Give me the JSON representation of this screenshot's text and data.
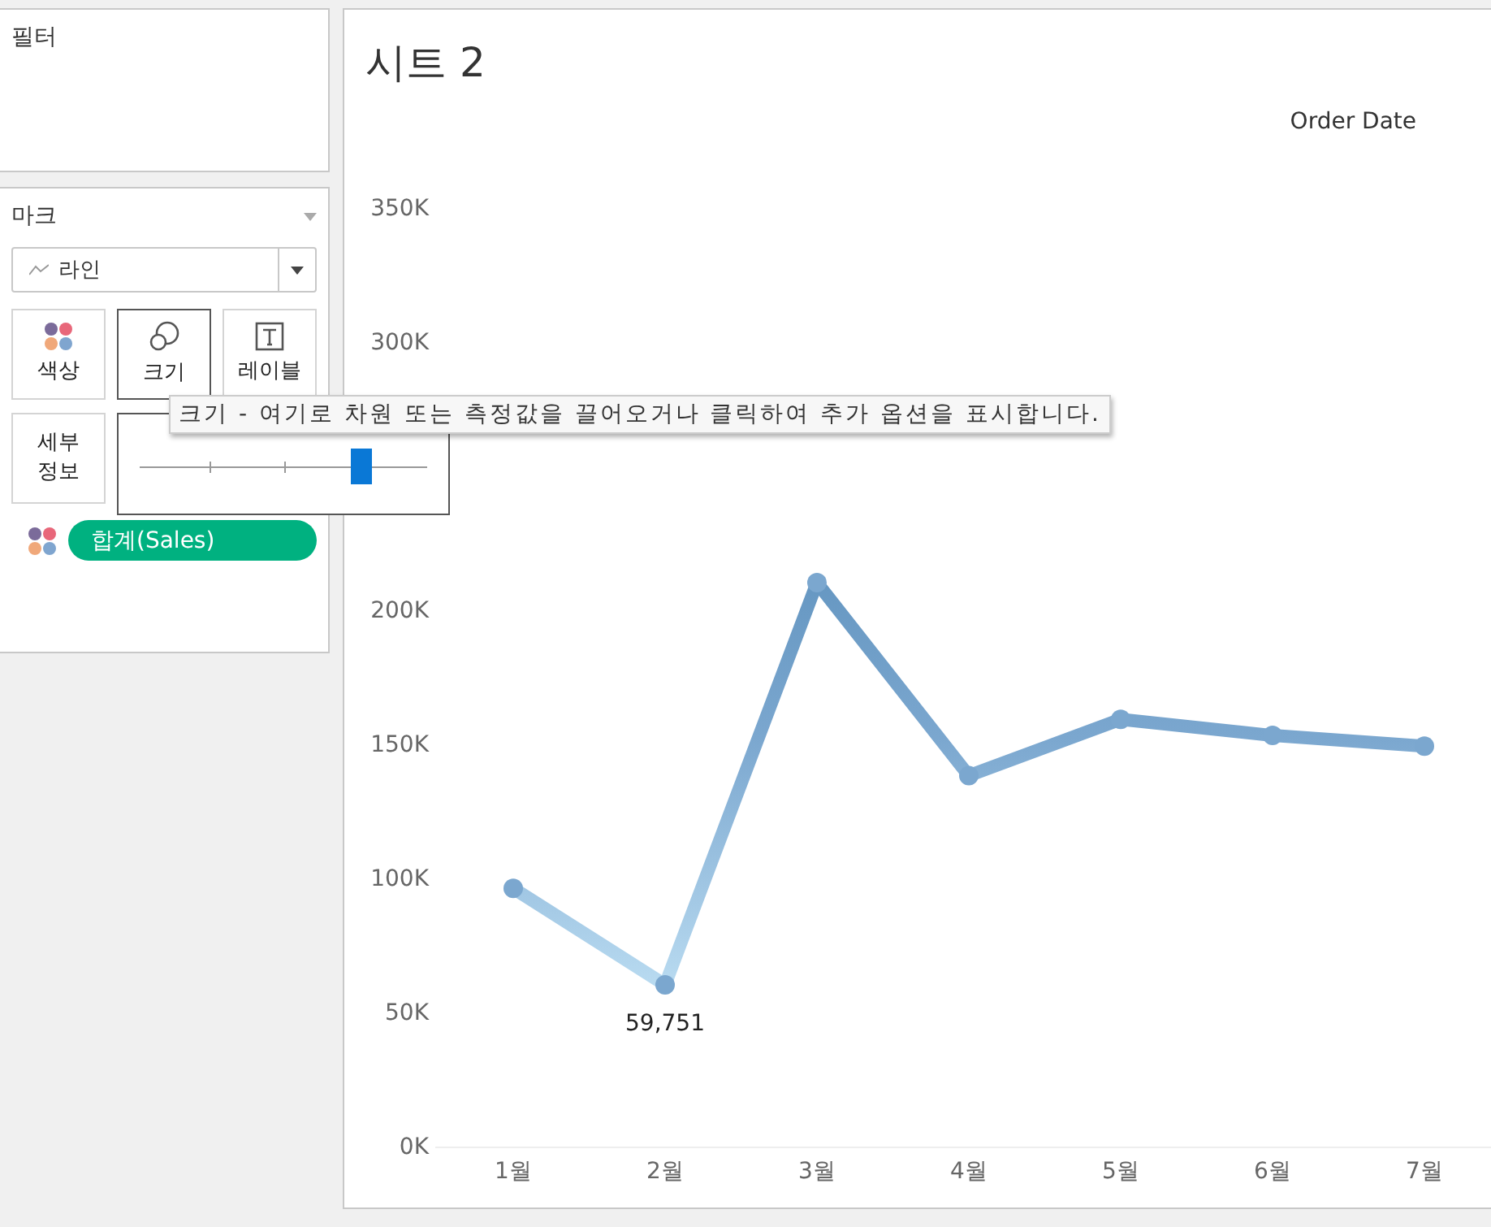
{
  "filter_panel": {
    "title": "필터"
  },
  "marks_panel": {
    "title": "마크",
    "mark_type": "라인",
    "cards": [
      {
        "label": "색상",
        "kind": "color",
        "selected": false
      },
      {
        "label": "크기",
        "kind": "size",
        "selected": true
      },
      {
        "label": "레이블",
        "kind": "label",
        "selected": false
      },
      {
        "label": "세부 정보",
        "kind": "detail",
        "selected": false
      }
    ],
    "pill": {
      "label": "합계(Sales)"
    }
  },
  "size_popup": {
    "level": 0.77
  },
  "tooltip": {
    "text": "크기 - 여기로 차원 또는 측정값을 끌어오거나 클릭하여 추가 옵션을 표시합니다."
  },
  "sheet": {
    "title": "시트 2",
    "column_header": "Order Date",
    "chart_data": {
      "type": "line",
      "categories": [
        "1월",
        "2월",
        "3월",
        "4월",
        "5월",
        "6월",
        "7월"
      ],
      "series": [
        {
          "color": "#7ba7cf",
          "marker": true,
          "values": [
            96000,
            60000,
            210000,
            138000,
            159000,
            153000,
            149000
          ]
        }
      ],
      "ylim": [
        0,
        350000
      ],
      "yticks": [
        {
          "value": 0,
          "label": "0K"
        },
        {
          "value": 50000,
          "label": "50K"
        },
        {
          "value": 100000,
          "label": "100K"
        },
        {
          "value": 150000,
          "label": "150K"
        },
        {
          "value": 200000,
          "label": "200K"
        },
        {
          "value": 300000,
          "label": "300K"
        },
        {
          "value": 350000,
          "label": "350K"
        }
      ],
      "annotations": [
        {
          "x": "2월",
          "y": 60000,
          "text": "59,751"
        }
      ]
    }
  }
}
